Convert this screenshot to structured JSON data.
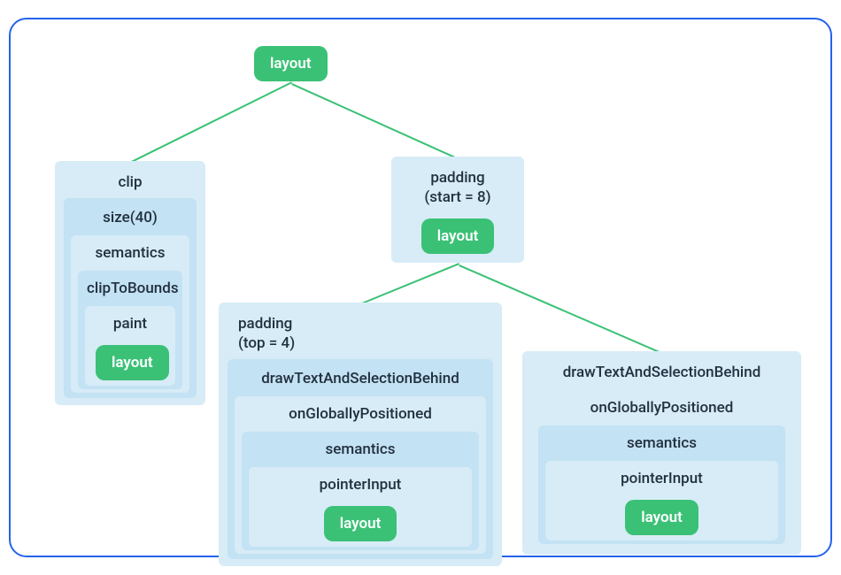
{
  "root": {
    "label": "layout"
  },
  "left": {
    "clip": "clip",
    "size": "size(40)",
    "semantics": "semantics",
    "clipToBounds": "clipToBounds",
    "paint": "paint",
    "layout": "layout"
  },
  "right": {
    "padding_label1": "padding",
    "padding_label2": "(start = 8)",
    "layout": "layout"
  },
  "child_left": {
    "padding_label1": "padding",
    "padding_label2": "(top = 4)",
    "drawTextAndSelectionBehind": "drawTextAndSelectionBehind",
    "onGloballyPositioned": "onGloballyPositioned",
    "semantics": "semantics",
    "pointerInput": "pointerInput",
    "layout": "layout"
  },
  "child_right": {
    "drawTextAndSelectionBehind": "drawTextAndSelectionBehind",
    "onGloballyPositioned": "onGloballyPositioned",
    "semantics": "semantics",
    "pointerInput": "pointerInput",
    "layout": "layout"
  }
}
